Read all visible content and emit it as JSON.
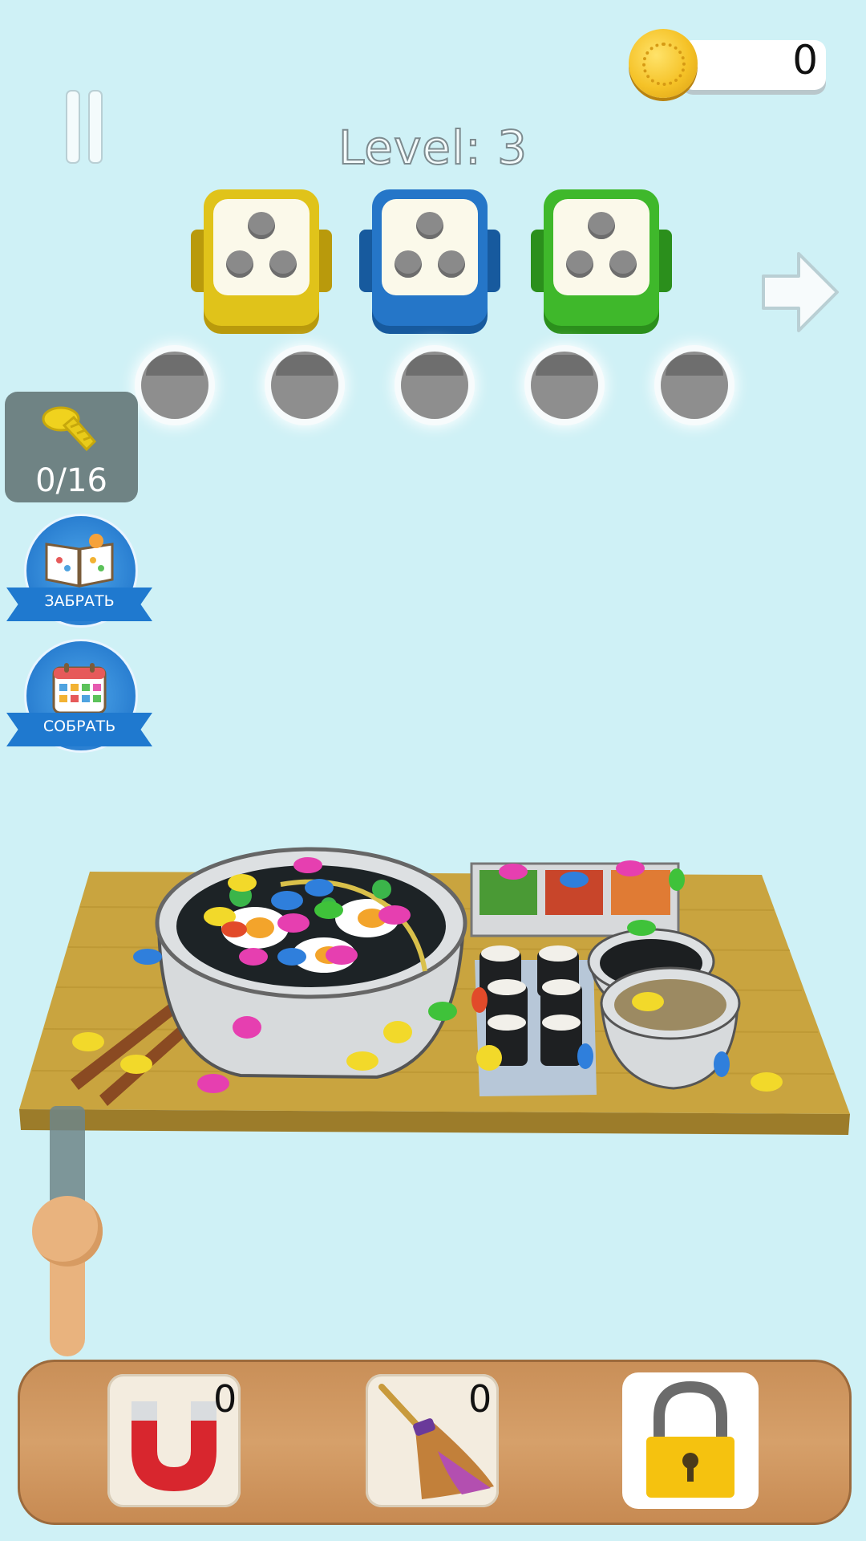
{
  "hud": {
    "coins": "0",
    "level_label": "Level: 3"
  },
  "boxes": [
    {
      "color": "yellow",
      "accent": "#e0c31a",
      "dark": "#b99a0c",
      "screw_slots": 3
    },
    {
      "color": "blue",
      "accent": "#2576c8",
      "dark": "#175a9e",
      "screw_slots": 3
    },
    {
      "color": "green",
      "accent": "#3fb82b",
      "dark": "#2b8f1c",
      "screw_slots": 3
    }
  ],
  "holding_slots": 5,
  "screw_counter": {
    "value": "0/16"
  },
  "rewards": [
    {
      "label": "ЗАБРАТЬ",
      "icon": "book-icon"
    },
    {
      "label": "СОБРАТЬ",
      "icon": "calendar-icon"
    }
  ],
  "boosters": [
    {
      "name": "magnet",
      "icon": "magnet-icon",
      "count": "0"
    },
    {
      "name": "broom",
      "icon": "broom-icon",
      "count": "0"
    },
    {
      "name": "unlock",
      "icon": "lock-icon"
    }
  ],
  "colors": {
    "background": "#cff1f6",
    "screw_pink": "#e63fb0",
    "screw_blue": "#2f7fdc",
    "screw_yellow": "#f2d92a",
    "screw_green": "#3fc23a"
  }
}
